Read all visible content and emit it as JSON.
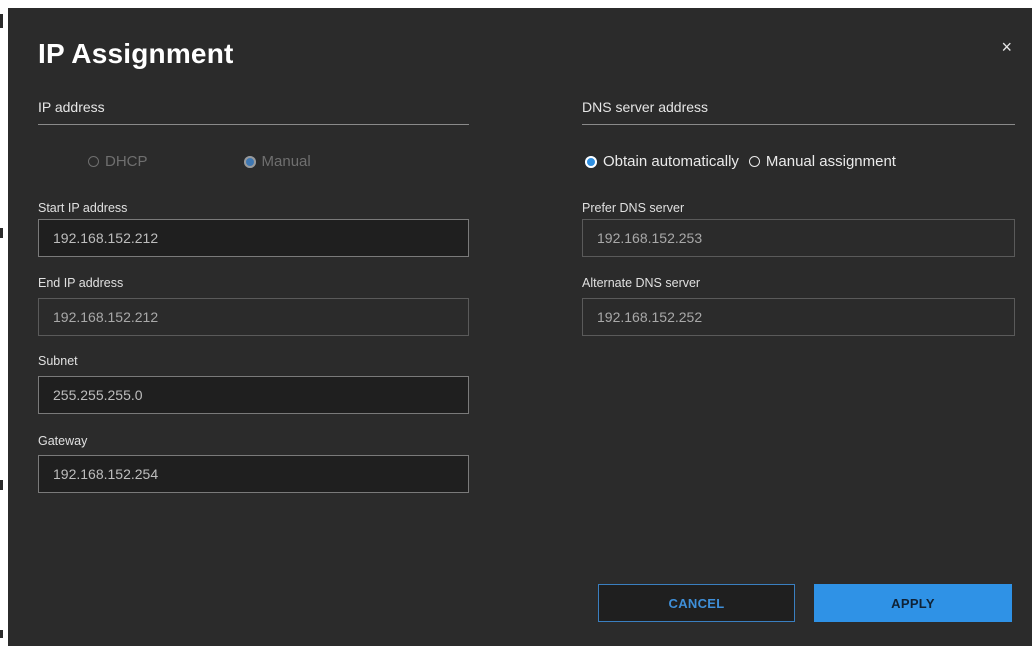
{
  "dialog": {
    "title": "IP Assignment",
    "close_icon": "close-icon",
    "close_glyph": "×"
  },
  "ip_section": {
    "heading": "IP address",
    "mode_options": [
      {
        "label": "DHCP",
        "checked": false,
        "disabled": true
      },
      {
        "label": "Manual",
        "checked": true,
        "disabled": true
      }
    ],
    "fields": {
      "start_ip": {
        "label": "Start IP address",
        "value": "192.168.152.212"
      },
      "end_ip": {
        "label": "End IP address",
        "value": "192.168.152.212"
      },
      "subnet": {
        "label": "Subnet",
        "value": "255.255.255.0"
      },
      "gateway": {
        "label": "Gateway",
        "value": "192.168.152.254"
      }
    }
  },
  "dns_section": {
    "heading": "DNS server address",
    "mode_options": [
      {
        "label": "Obtain automatically",
        "checked": true,
        "disabled": false
      },
      {
        "label": "Manual assignment",
        "checked": false,
        "disabled": false
      }
    ],
    "fields": {
      "prefer": {
        "label": "Prefer DNS server",
        "value": "192.168.152.253"
      },
      "alternate": {
        "label": "Alternate DNS server",
        "value": "192.168.152.252"
      }
    }
  },
  "buttons": {
    "cancel_label": "CANCEL",
    "apply_label": "APPLY"
  },
  "colors": {
    "background": "#2b2b2b",
    "accent": "#2f92e6",
    "field_dark": "#1f1f1f"
  }
}
